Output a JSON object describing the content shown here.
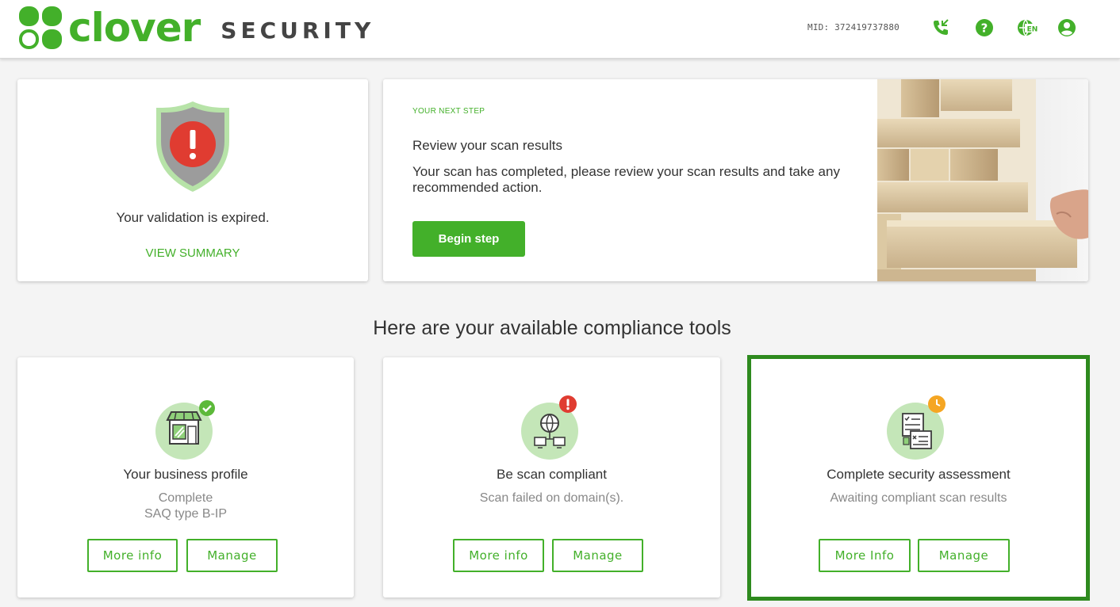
{
  "header": {
    "logo_word": "clover",
    "logo_sub": "SECURITY",
    "mid": "MID: 372419737880",
    "lang": "EN",
    "icons": [
      "phone-icon",
      "help-icon",
      "language-globe-icon",
      "user-account-icon"
    ],
    "brand_color": "#43b02a"
  },
  "validation": {
    "status_text": "Your validation is expired.",
    "link": "VIEW SUMMARY",
    "alert_color": "#e03c31"
  },
  "next_step": {
    "label": "YOUR NEXT STEP",
    "title": "Review your scan results",
    "description": "Your scan has completed, please review your scan results and take any recommended action.",
    "button": "Begin step"
  },
  "tools_heading": "Here are your available compliance tools",
  "tools": [
    {
      "title": "Your business profile",
      "status_line1": "Complete",
      "status_line2": "SAQ type B-IP",
      "badge": "check",
      "badge_color": "#5cb93a",
      "more_label": "More info",
      "manage_label": "Manage"
    },
    {
      "title": "Be scan compliant",
      "status_line1": "Scan failed on domain(s).",
      "status_line2": "",
      "badge": "alert",
      "badge_color": "#e03c31",
      "more_label": "More info",
      "manage_label": "Manage"
    },
    {
      "title": "Complete security assessment",
      "status_line1": "Awaiting compliant scan results",
      "status_line2": "",
      "badge": "clock",
      "badge_color": "#f5a623",
      "more_label": "More Info",
      "manage_label": "Manage"
    }
  ]
}
